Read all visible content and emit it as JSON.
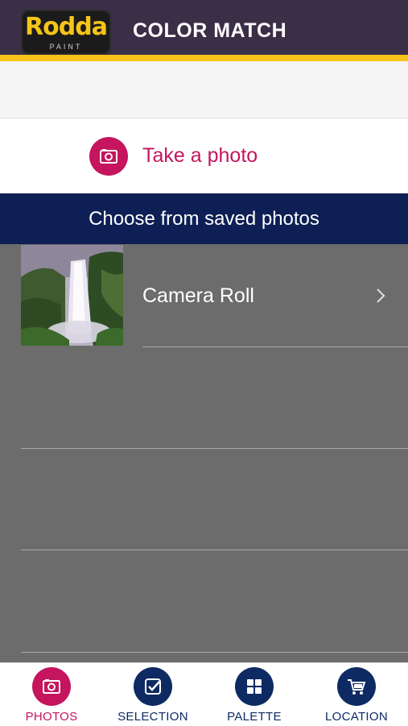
{
  "header": {
    "logo_text": "Rodda",
    "logo_subtext": "PAINT",
    "title": "COLOR MATCH",
    "colors": {
      "bar": "#3b2f47",
      "stripe": "#f7c21a"
    }
  },
  "take_photo": {
    "label": "Take a photo",
    "icon": "camera-icon",
    "color": "#c4155e"
  },
  "choose_bar": {
    "label": "Choose from saved photos",
    "color": "#0e1f55"
  },
  "albums": [
    {
      "label": "Camera Roll",
      "icon": "chevron-right-icon"
    }
  ],
  "tabs": [
    {
      "label": "PHOTOS",
      "icon": "camera-icon",
      "active": true
    },
    {
      "label": "SELECTION",
      "icon": "checkbox-icon",
      "active": false
    },
    {
      "label": "PALETTE",
      "icon": "grid-icon",
      "active": false
    },
    {
      "label": "LOCATION",
      "icon": "cart-icon",
      "active": false
    }
  ],
  "colors": {
    "active_tab": "#c4155e",
    "inactive_tab": "#0e2a63",
    "list_bg": "#6c6c6c"
  }
}
